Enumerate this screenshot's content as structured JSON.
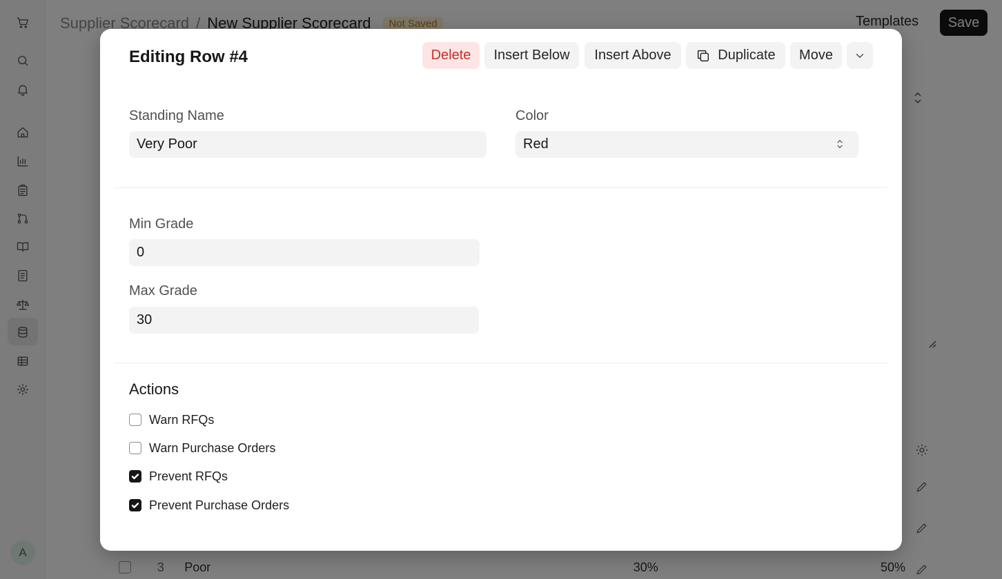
{
  "background": {
    "breadcrumb": {
      "parent": "Supplier Scorecard",
      "separator": "/",
      "current": "New Supplier Scorecard"
    },
    "status_badge": "Not Saved",
    "templates_label": "Templates",
    "save_label": "Save",
    "avatar_letter": "A",
    "partial_row": {
      "index": "3",
      "name": "Poor",
      "min": "30%",
      "max": "50%"
    }
  },
  "modal": {
    "title": "Editing Row #4",
    "toolbar": {
      "delete": "Delete",
      "insert_below": "Insert Below",
      "insert_above": "Insert Above",
      "duplicate": "Duplicate",
      "move": "Move"
    },
    "fields": {
      "standing_name": {
        "label": "Standing Name",
        "value": "Very Poor"
      },
      "color": {
        "label": "Color",
        "value": "Red"
      },
      "min_grade": {
        "label": "Min Grade",
        "value": "0"
      },
      "max_grade": {
        "label": "Max Grade",
        "value": "30"
      }
    },
    "actions": {
      "title": "Actions",
      "items": [
        {
          "label": "Warn RFQs",
          "checked": false
        },
        {
          "label": "Warn Purchase Orders",
          "checked": false
        },
        {
          "label": "Prevent RFQs",
          "checked": true
        },
        {
          "label": "Prevent Purchase Orders",
          "checked": true
        }
      ]
    }
  }
}
